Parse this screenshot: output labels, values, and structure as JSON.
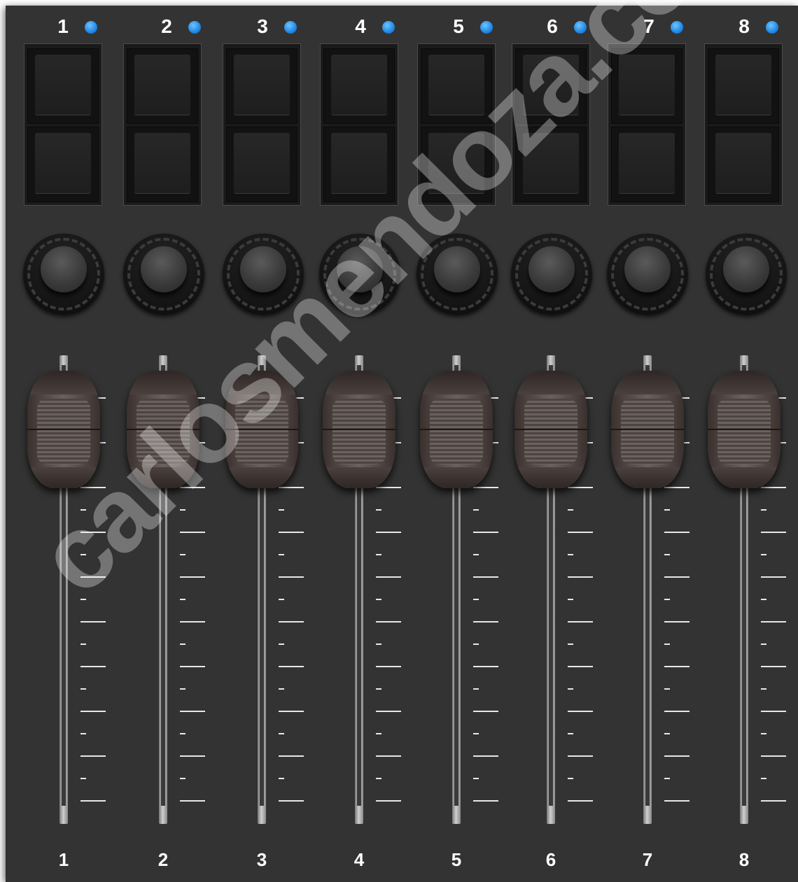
{
  "channels": [
    {
      "number": "1",
      "fader_label": "1"
    },
    {
      "number": "2",
      "fader_label": "2"
    },
    {
      "number": "3",
      "fader_label": "3"
    },
    {
      "number": "4",
      "fader_label": "4"
    },
    {
      "number": "5",
      "fader_label": "5"
    },
    {
      "number": "6",
      "fader_label": "6"
    },
    {
      "number": "7",
      "fader_label": "7"
    },
    {
      "number": "8",
      "fader_label": "8"
    }
  ],
  "colors": {
    "panel": "#333333",
    "led": "#1e88e5",
    "text": "#ffffff"
  },
  "watermark": "carlosmendoza.com"
}
